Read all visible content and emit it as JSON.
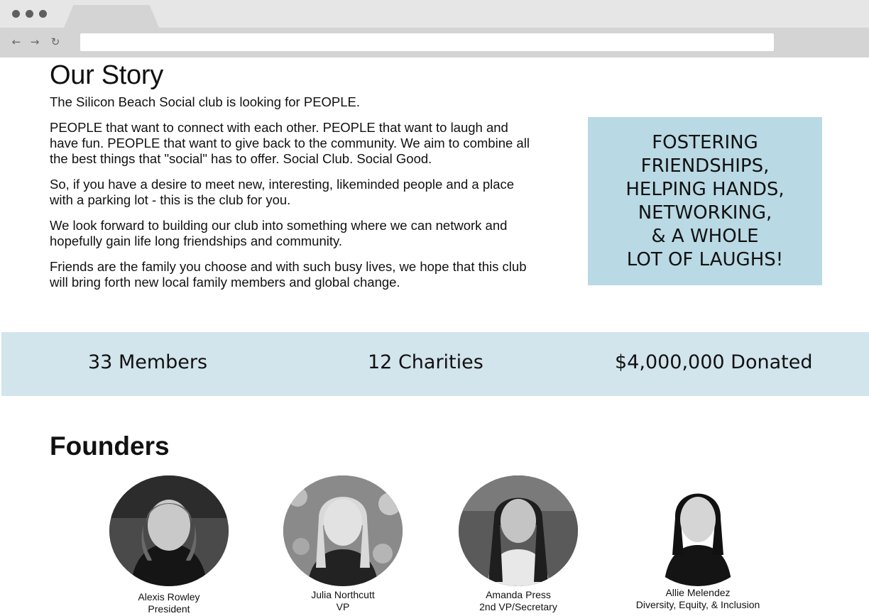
{
  "browser": {
    "nav": {
      "back_icon": "←",
      "forward_icon": "→",
      "reload_icon": "↻"
    }
  },
  "story": {
    "title": "Our Story",
    "paragraphs": [
      "The Silicon Beach Social club is looking for PEOPLE.",
      "PEOPLE that want to connect with each other. PEOPLE that want to laugh and have fun. PEOPLE that want to give back to the community. We aim to combine all the best things that \"social\" has to offer. Social Club. Social Good.",
      "So, if you have a desire to meet new, interesting, likeminded people and a place with a parking lot - this is the club for you.",
      "We look forward to building our club into something where we can network and hopefully gain life long friendships and community.",
      "Friends are the family you choose and with such busy lives, we hope that this club will bring forth new local family members and global change."
    ],
    "highlight": "FOSTERING\nFRIENDSHIPS,\nHELPING HANDS,\nNETWORKING,\n& A WHOLE\nLOT OF LAUGHS!"
  },
  "stats": [
    {
      "label": "33 Members"
    },
    {
      "label": "12 Charities"
    },
    {
      "label": "$4,000,000 Donated"
    }
  ],
  "founders": {
    "title": "Founders",
    "people": [
      {
        "name": "Alexis Rowley",
        "role": "President"
      },
      {
        "name": "Julia Northcutt",
        "role": "VP"
      },
      {
        "name": "Amanda Press",
        "role": "2nd VP/Secretary"
      },
      {
        "name": "Allie Melendez",
        "role": "Diversity, Equity, & Inclusion"
      }
    ]
  },
  "colors": {
    "highlight_bg": "#b9d9e4",
    "stats_bg": "#d2e4ec"
  }
}
